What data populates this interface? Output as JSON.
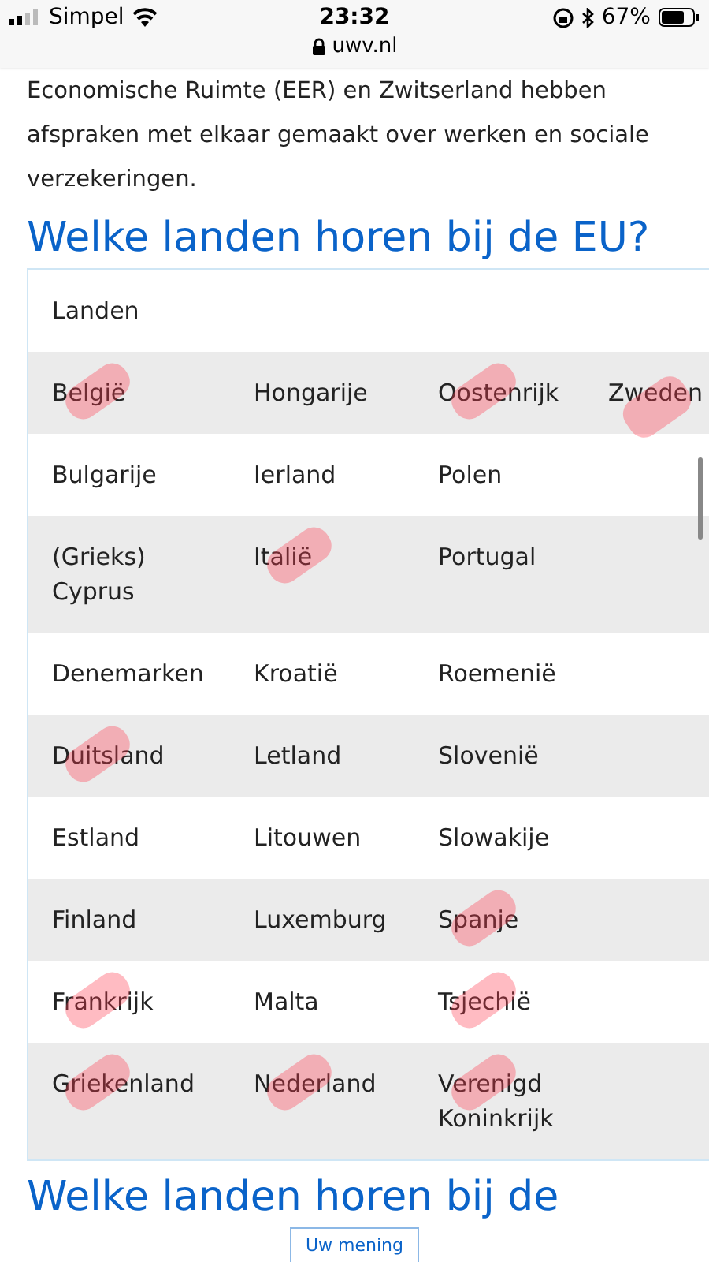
{
  "status_bar": {
    "carrier": "Simpel",
    "time": "23:32",
    "battery": "67%"
  },
  "address_bar": {
    "url": "uwv.nl"
  },
  "intro": [
    "Economische Ruimte (EER) en Zwitserland hebben",
    "afspraken met elkaar gemaakt over werken en sociale",
    "verzekeringen."
  ],
  "heading": "Welke landen horen bij de EU?",
  "table": {
    "header": "Landen",
    "rows": [
      [
        {
          "text": "België",
          "marked": true
        },
        {
          "text": "Hongarije",
          "marked": false
        },
        {
          "text": "Oostenrijk",
          "marked": true
        },
        {
          "text": "Zweden",
          "marked": true
        }
      ],
      [
        {
          "text": "Bulgarije",
          "marked": false
        },
        {
          "text": "Ierland",
          "marked": false
        },
        {
          "text": "Polen",
          "marked": false
        }
      ],
      [
        {
          "text": "(Grieks) Cyprus",
          "marked": false
        },
        {
          "text": "Italië",
          "marked": true
        },
        {
          "text": "Portugal",
          "marked": false
        }
      ],
      [
        {
          "text": "Denemarken",
          "marked": false
        },
        {
          "text": "Kroatië",
          "marked": false
        },
        {
          "text": "Roemenië",
          "marked": false
        }
      ],
      [
        {
          "text": "Duitsland",
          "marked": true
        },
        {
          "text": "Letland",
          "marked": false
        },
        {
          "text": "Slovenië",
          "marked": false
        }
      ],
      [
        {
          "text": "Estland",
          "marked": false
        },
        {
          "text": "Litouwen",
          "marked": false
        },
        {
          "text": "Slowakije",
          "marked": false
        }
      ],
      [
        {
          "text": "Finland",
          "marked": false
        },
        {
          "text": "Luxemburg",
          "marked": false
        },
        {
          "text": "Spanje",
          "marked": true
        }
      ],
      [
        {
          "text": "Frankrijk",
          "marked": true
        },
        {
          "text": "Malta",
          "marked": false
        },
        {
          "text": "Tsjechië",
          "marked": true
        }
      ],
      [
        {
          "text": "Griekenland",
          "marked": true
        },
        {
          "text": "Nederland",
          "marked": true
        },
        {
          "text": "Verenigd Koninkrijk",
          "marked": true
        }
      ]
    ]
  },
  "heading_2": "Welke landen horen bij de",
  "feedback_button": "Uw mening"
}
